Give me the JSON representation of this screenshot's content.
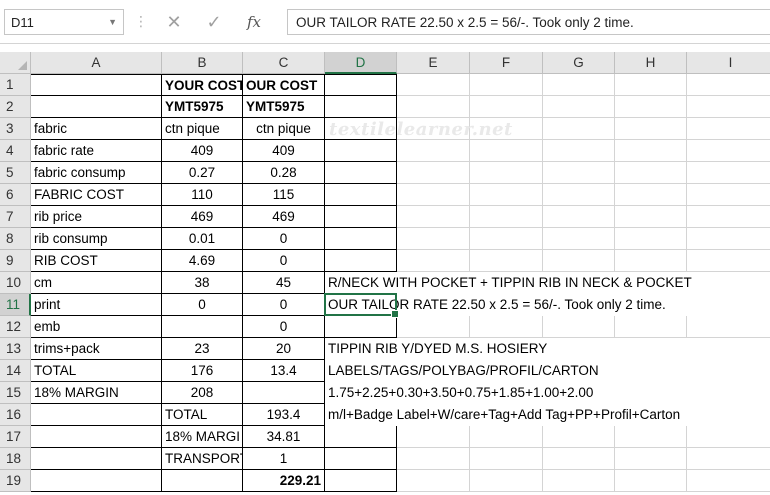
{
  "formula_bar": {
    "name_box": "D11",
    "content": "OUR TAILOR RATE  22.50 x 2.5 = 56/-. Took only 2 time.",
    "cancel_icon": "close-icon",
    "enter_icon": "checkmark-icon",
    "fx_label": "fx"
  },
  "columns": [
    "A",
    "B",
    "C",
    "D",
    "E",
    "F",
    "G",
    "H",
    "I"
  ],
  "selected_column": "D",
  "selected_row": "11",
  "rows": [
    {
      "n": "1",
      "A": "",
      "B": "YOUR COST",
      "C": "OUR COST",
      "D": ""
    },
    {
      "n": "2",
      "A": "",
      "B": "YMT5975",
      "C": "YMT5975",
      "D": ""
    },
    {
      "n": "3",
      "A": "fabric",
      "B": "ctn pique",
      "C": "ctn pique",
      "D": ""
    },
    {
      "n": "4",
      "A": "fabric rate",
      "B": "409",
      "C": "409",
      "D": ""
    },
    {
      "n": "5",
      "A": "fabric consump",
      "B": "0.27",
      "C": "0.28",
      "D": ""
    },
    {
      "n": "6",
      "A": "FABRIC COST",
      "B": "110",
      "C": "115",
      "D": ""
    },
    {
      "n": "7",
      "A": "rib price",
      "B": "469",
      "C": "469",
      "D": ""
    },
    {
      "n": "8",
      "A": "rib consump",
      "B": "0.01",
      "C": "0",
      "D": ""
    },
    {
      "n": "9",
      "A": "RIB COST",
      "B": "4.69",
      "C": "0",
      "D": ""
    },
    {
      "n": "10",
      "A": "cm",
      "B": "38",
      "C": "45",
      "D": "R/NECK WITH POCKET + TIPPIN RIB IN NECK & POCKET"
    },
    {
      "n": "11",
      "A": "print",
      "B": "0",
      "C": "0",
      "D": "OUR TAILOR RATE  22.50 x 2.5 = 56/-. Took only 2 time."
    },
    {
      "n": "12",
      "A": "emb",
      "B": "",
      "C": "0",
      "D": ""
    },
    {
      "n": "13",
      "A": "trims+pack",
      "B": "23",
      "C": "20",
      "D": "TIPPIN RIB  Y/DYED   M.S. HOSIERY"
    },
    {
      "n": "14",
      "A": "TOTAL",
      "B": "176",
      "C": "13.4",
      "D": "LABELS/TAGS/POLYBAG/PROFIL/CARTON"
    },
    {
      "n": "15",
      "A": "18% MARGIN",
      "B": "208",
      "C": "",
      "D": "1.75+2.25+0.30+3.50+0.75+1.85+1.00+2.00"
    },
    {
      "n": "16",
      "A": "",
      "B": "TOTAL",
      "C": "193.4",
      "D": "m/l+Badge Label+W/care+Tag+Add Tag+PP+Profil+Carton"
    },
    {
      "n": "17",
      "A": "",
      "B": "18% MARGI",
      "C": "34.81",
      "D": ""
    },
    {
      "n": "18",
      "A": "",
      "B": "TRANSPORT",
      "C": "1",
      "D": ""
    },
    {
      "n": "19",
      "A": "",
      "B": "",
      "C": "229.21",
      "D": ""
    }
  ],
  "watermark": "textilelearner.net"
}
